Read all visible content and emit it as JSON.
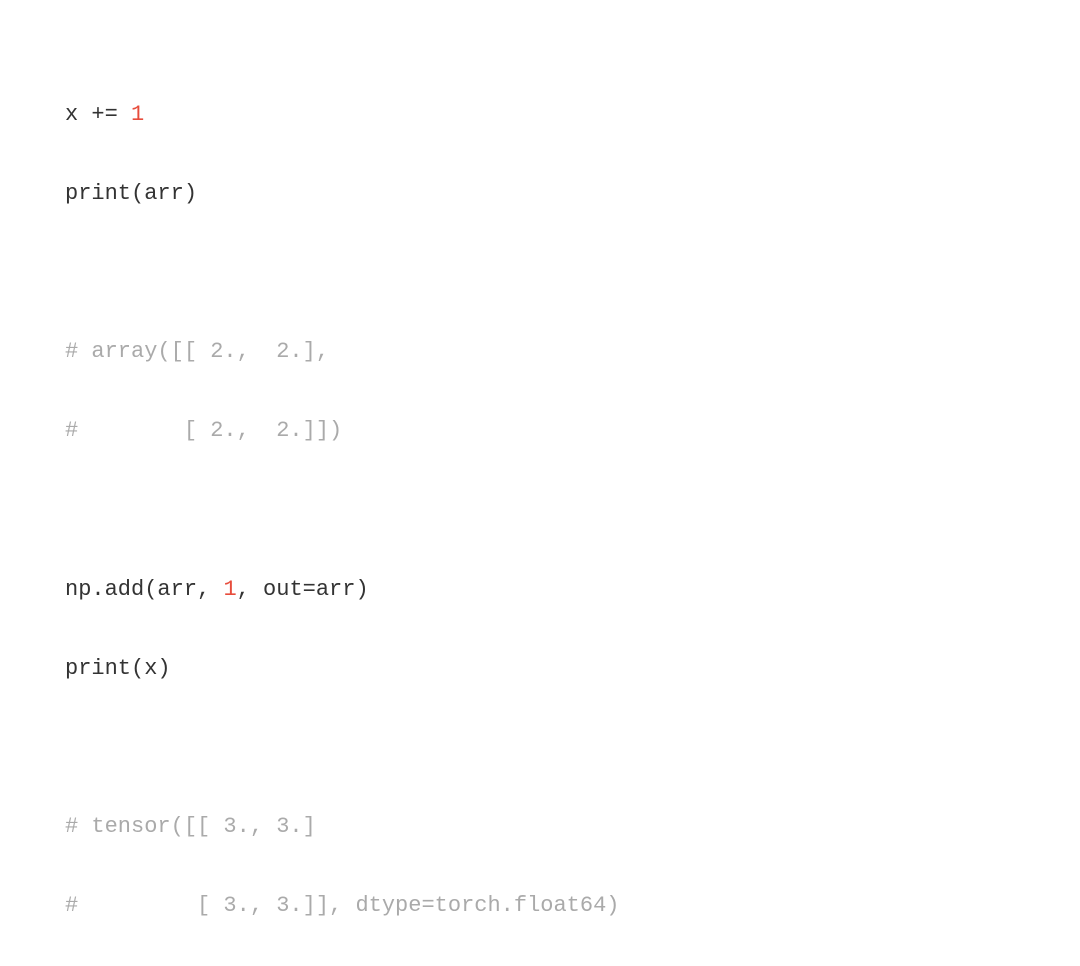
{
  "lines": {
    "l1_part1": "x += ",
    "l1_num": "1",
    "l2": "print(arr)",
    "l3": "",
    "l4": "# array([[ 2.,  2.],",
    "l5": "#        [ 2.,  2.]])",
    "l6": "",
    "l7_part1": "np.add(arr, ",
    "l7_num": "1",
    "l7_part2": ", out=arr)",
    "l8": "print(x)",
    "l9": "",
    "l10": "# tensor([[ 3., 3.]",
    "l11": "#         [ 3., 3.]], dtype=torch.float64)"
  }
}
